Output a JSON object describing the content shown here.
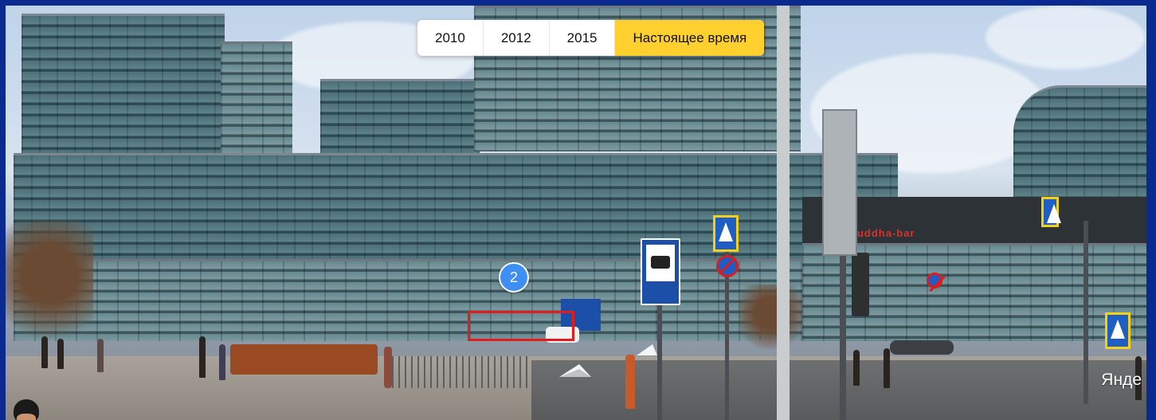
{
  "timeline": {
    "years": [
      {
        "label": "2010",
        "active": false
      },
      {
        "label": "2012",
        "active": false
      },
      {
        "label": "2015",
        "active": false
      },
      {
        "label": "Настоящее время",
        "active": true
      }
    ]
  },
  "panorama": {
    "marker_number": "2",
    "storefront_sign": "buddha-bar",
    "watermark": "Янде"
  },
  "colors": {
    "frame": "#0b2a8f",
    "active_year": "#ffd02e",
    "marker": "#3d8ff4",
    "highlight_box": "#e21b1b"
  }
}
